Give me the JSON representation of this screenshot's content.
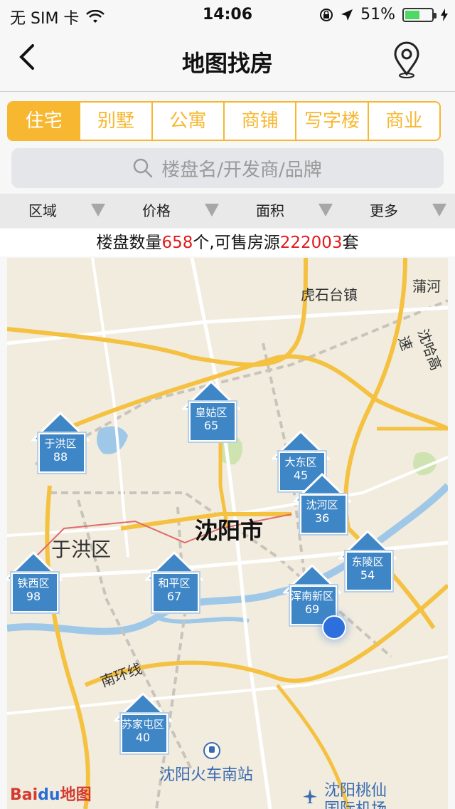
{
  "status_bar": {
    "carrier": "无 SIM 卡",
    "time": "14:06",
    "battery": "51%",
    "battery_level": 0.51
  },
  "nav": {
    "title": "地图找房",
    "back_icon": "back-chevron-icon",
    "location_icon": "location-pin-icon"
  },
  "tabs": [
    {
      "label": "住宅",
      "active": true
    },
    {
      "label": "别墅",
      "active": false
    },
    {
      "label": "公寓",
      "active": false
    },
    {
      "label": "商铺",
      "active": false
    },
    {
      "label": "写字楼",
      "active": false
    },
    {
      "label": "商业",
      "active": false
    }
  ],
  "search": {
    "placeholder": "楼盘名/开发商/品牌"
  },
  "filters": [
    {
      "label": "区域"
    },
    {
      "label": "价格"
    },
    {
      "label": "面积"
    },
    {
      "label": "更多"
    }
  ],
  "summary": {
    "prefix": "楼盘数量",
    "count": "658",
    "mid": "个,可售房源",
    "houses": "222003",
    "suffix": "套"
  },
  "map": {
    "city": "沈阳市",
    "labels": [
      "虎石台镇",
      "蒲河",
      "沈哈高速",
      "于洪区",
      "南环线",
      "沈阳火车南站",
      "沈阳桃仙",
      "国际机场"
    ],
    "pins": [
      {
        "name": "皇姑区",
        "count": "65"
      },
      {
        "name": "于洪区",
        "count": "88"
      },
      {
        "name": "大东区",
        "count": "45"
      },
      {
        "name": "沈河区",
        "count": "36"
      },
      {
        "name": "东陵区",
        "count": "54"
      },
      {
        "name": "铁西区",
        "count": "98"
      },
      {
        "name": "和平区",
        "count": "67"
      },
      {
        "name": "浑南新区",
        "count": "69"
      },
      {
        "name": "苏家屯区",
        "count": "40"
      }
    ],
    "baidu_logo": {
      "part1": "Bai",
      "part2": "du",
      "part3": "地图"
    }
  },
  "colors": {
    "accent": "#f7b731",
    "pin_blue": "#3f86c6",
    "highlight_red": "#e21b1b"
  }
}
